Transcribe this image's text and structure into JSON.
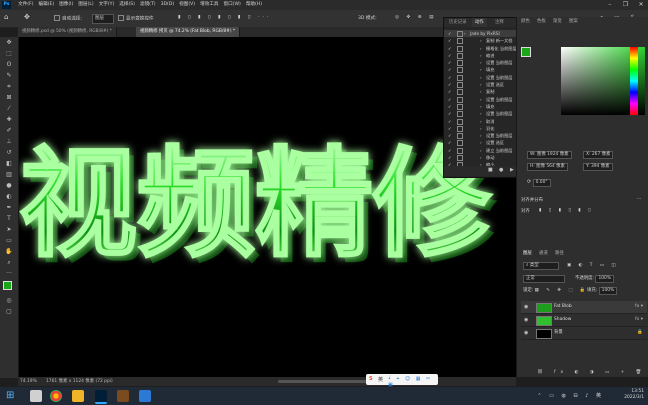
{
  "app": {
    "logo": "Ps"
  },
  "menu": [
    "文件(F)",
    "编辑(E)",
    "图像(I)",
    "图层(L)",
    "文字(Y)",
    "选择(S)",
    "滤镜(T)",
    "3D(D)",
    "视图(V)",
    "增效工具",
    "窗口(W)",
    "帮助(H)"
  ],
  "window_controls": [
    "–",
    "❐",
    "✕"
  ],
  "options_bar": {
    "auto_select_label": "自动选择:",
    "auto_select_value": "图层",
    "show_transform_label": "显示变换控件",
    "mode_label": "3D 模式:"
  },
  "tabs": [
    {
      "label": "视频精修.psd @ 50% (视频精修, RGB/8#) *",
      "active": false
    },
    {
      "label": "视频精修 拷贝 @ 74.2% (Fat Blob, RGB/8#) *",
      "active": true
    }
  ],
  "canvas_text": "视频精修",
  "status": {
    "zoom": "74.19%",
    "size": "1761 像素 x 1124 像素 (72 ppi)"
  },
  "history_panel": {
    "tabs": [
      {
        "label": "历史记录",
        "active": false
      },
      {
        "label": "动作",
        "active": true
      },
      {
        "label": "注释",
        "active": false
      }
    ],
    "items": [
      {
        "label": "Jade by PixRSI",
        "level": 0,
        "selected": true
      },
      {
        "label": "复制 新一文档",
        "level": 1
      },
      {
        "label": "栅格化 当前图层",
        "level": 1
      },
      {
        "label": "缩进",
        "level": 1
      },
      {
        "label": "设置 当前图层",
        "level": 1
      },
      {
        "label": "填充",
        "level": 1
      },
      {
        "label": "设置 当前图层",
        "level": 1
      },
      {
        "label": "设置 选区",
        "level": 1
      },
      {
        "label": "复制",
        "level": 1
      },
      {
        "label": "设置 当前图层",
        "level": 1
      },
      {
        "label": "填充",
        "level": 1
      },
      {
        "label": "设置 当前图层",
        "level": 1
      },
      {
        "label": "取消",
        "level": 1
      },
      {
        "label": "羽化",
        "level": 1
      },
      {
        "label": "设置 当前图层",
        "level": 1
      },
      {
        "label": "设置 选区",
        "level": 1
      },
      {
        "label": "建立 当前图层",
        "level": 1
      },
      {
        "label": "移动",
        "level": 1
      },
      {
        "label": "缩小",
        "level": 1
      }
    ],
    "footer_icons": [
      "■",
      "●",
      "▶",
      "▬",
      "▭",
      "+",
      "🗑"
    ]
  },
  "color_panel": {
    "tabs": [
      "颜色",
      "色板",
      "渐变",
      "图案"
    ],
    "accent": "#2bd12b"
  },
  "properties": {
    "w_label": "W: 图像 1924 像素",
    "h_label": "H: 图像 564 像素",
    "x_label": "X: 267 像素",
    "y_label": "Y: 394 像素",
    "angle": "0.00°",
    "align_label": "对齐",
    "distribute_label": "对齐并分布"
  },
  "layers_panel": {
    "tabs": [
      {
        "label": "图层",
        "active": true
      },
      {
        "label": "通道",
        "active": false
      },
      {
        "label": "路径",
        "active": false
      }
    ],
    "filter_label": "类型",
    "blend_mode": "正常",
    "opacity_label": "不透明度:",
    "opacity_value": "100%",
    "lock_label": "锁定:",
    "fill_label": "填充:",
    "fill_value": "100%",
    "layers": [
      {
        "name": "Fat Blob",
        "thumb_color": "#1c9e1c",
        "selected": true,
        "fx": true
      },
      {
        "name": "Shadow",
        "thumb_color": "#2fbf2f",
        "selected": false,
        "fx": true
      },
      {
        "name": "背景",
        "thumb_color": "#000000",
        "selected": false,
        "fx": false
      }
    ]
  },
  "ime": {
    "label": "英"
  },
  "taskbar": {
    "time": "13:51",
    "date": "2022/3/1"
  }
}
